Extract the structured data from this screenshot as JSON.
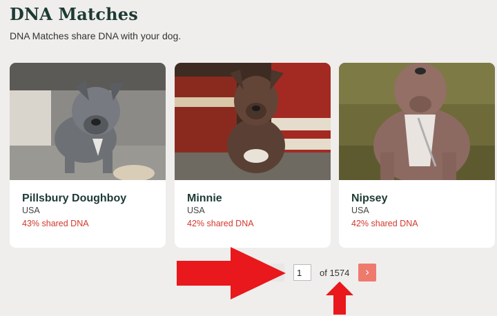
{
  "header": {
    "title": "DNA Matches",
    "subtitle": "DNA Matches share DNA with your dog."
  },
  "cards": [
    {
      "name": "Pillsbury Doughboy",
      "location": "USA",
      "shared": "43% shared DNA"
    },
    {
      "name": "Minnie",
      "location": "USA",
      "shared": "42% shared DNA"
    },
    {
      "name": "Nipsey",
      "location": "USA",
      "shared": "42% shared DNA"
    }
  ],
  "pagination": {
    "page_value": "1",
    "of_text": "of 1574",
    "next_label": "›"
  },
  "colors": {
    "accent_red": "#e8181c",
    "dna_text": "#d2382c",
    "next_button": "#ee7a6e",
    "title": "#1d3a34"
  },
  "icons": {
    "next": "chevron-right-icon",
    "annotation": "red-arrow-icon"
  }
}
